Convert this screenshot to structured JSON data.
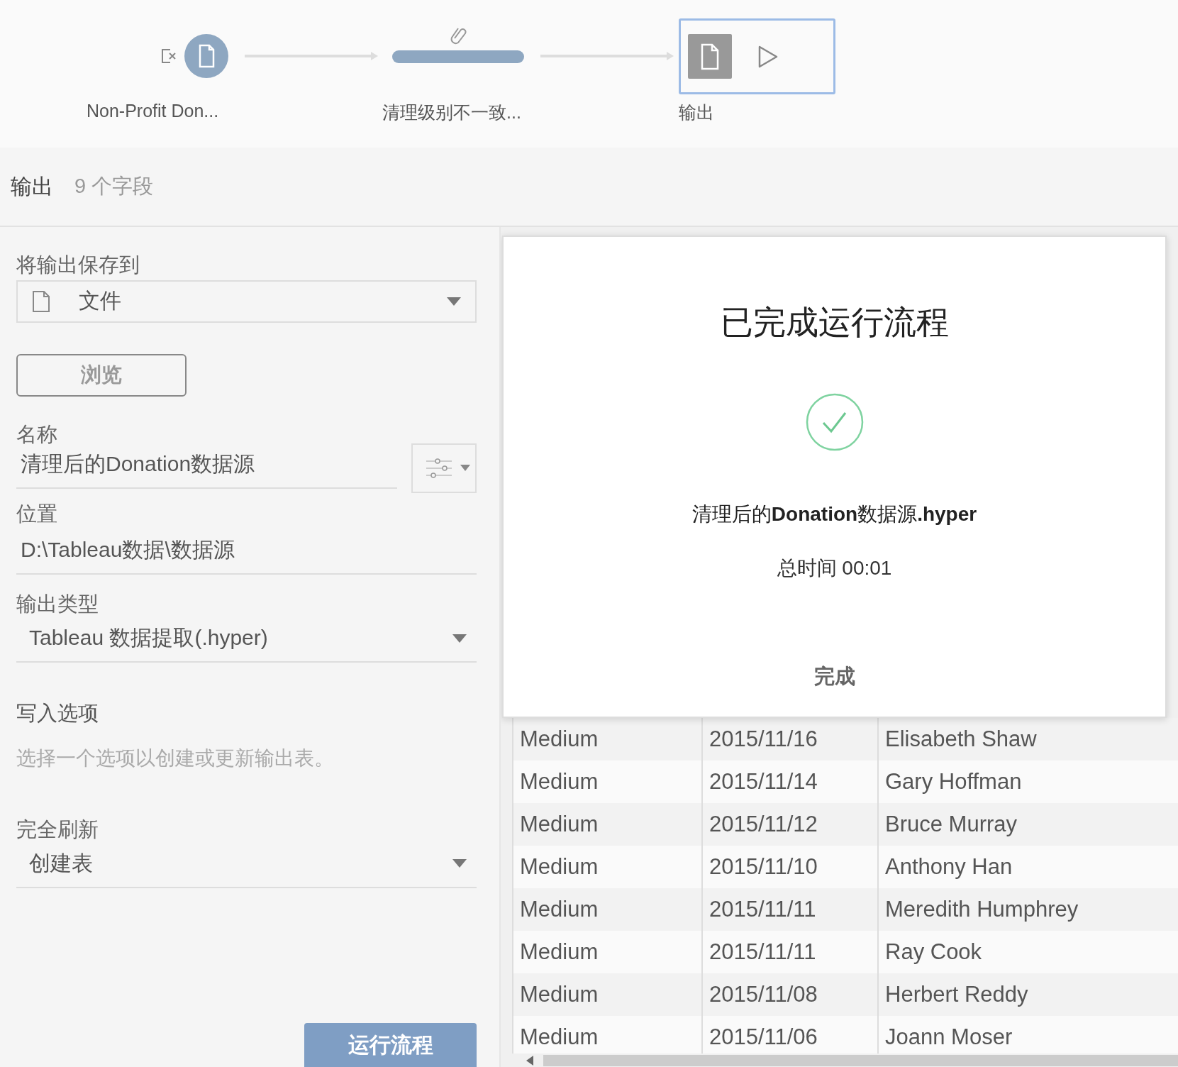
{
  "flow": {
    "steps": [
      {
        "kind": "input",
        "label": "Non-Profit Don...",
        "selected": false
      },
      {
        "kind": "clean",
        "label": "清理级别不一致...",
        "selected": false
      },
      {
        "kind": "output",
        "label": "输出",
        "selected": true
      }
    ]
  },
  "header": {
    "title": "输出",
    "field_count": "9 个字段"
  },
  "settings": {
    "save_to_label": "将输出保存到",
    "save_to_value": "文件",
    "browse_button": "浏览",
    "name_label": "名称",
    "name_value": "清理后的Donation数据源",
    "location_label": "位置",
    "location_value": "D:\\Tableau数据\\数据源",
    "output_type_label": "输出类型",
    "output_type_value": "Tableau 数据提取(.hyper)",
    "write_options_title": "写入选项",
    "write_options_hint": "选择一个选项以创建或更新输出表。",
    "refresh_label": "完全刷新",
    "refresh_value": "创建表",
    "run_button": "运行流程"
  },
  "table": {
    "rows": [
      {
        "column_1": "Medium",
        "column_2": "2015/11/16",
        "column_3": "Elisabeth Shaw"
      },
      {
        "column_1": "Medium",
        "column_2": "2015/11/14",
        "column_3": "Gary Hoffman"
      },
      {
        "column_1": "Medium",
        "column_2": "2015/11/12",
        "column_3": "Bruce Murray"
      },
      {
        "column_1": "Medium",
        "column_2": "2015/11/10",
        "column_3": "Anthony Han"
      },
      {
        "column_1": "Medium",
        "column_2": "2015/11/11",
        "column_3": "Meredith Humphrey"
      },
      {
        "column_1": "Medium",
        "column_2": "2015/11/11",
        "column_3": "Ray Cook"
      },
      {
        "column_1": "Medium",
        "column_2": "2015/11/08",
        "column_3": "Herbert Reddy"
      },
      {
        "column_1": "Medium",
        "column_2": "2015/11/06",
        "column_3": "Joann Moser"
      }
    ]
  },
  "dialog": {
    "title": "已完成运行流程",
    "file_name": "清理后的**Donation**数据源**.hyper**",
    "total_time": "总时间 00:01",
    "done_button": "完成"
  }
}
